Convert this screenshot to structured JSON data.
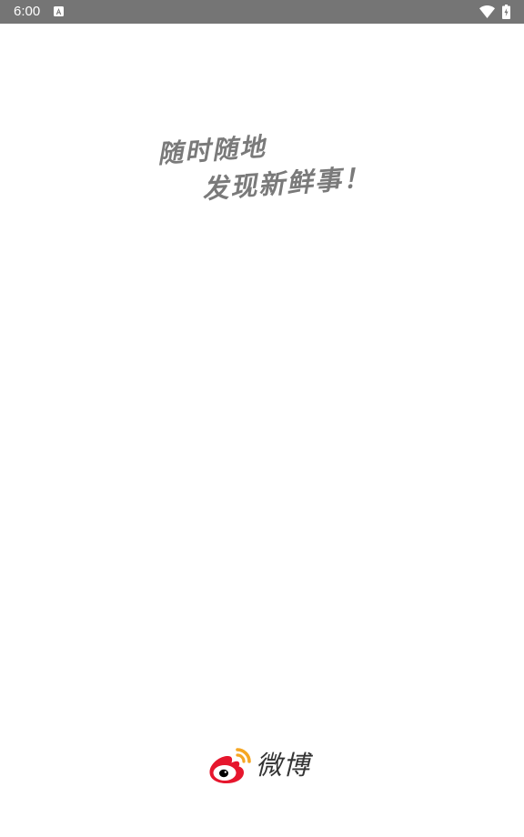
{
  "status_bar": {
    "time": "6:00",
    "background_color": "#757575",
    "icons": [
      "notification-a-icon",
      "wifi-icon",
      "battery-charging-icon"
    ]
  },
  "splash": {
    "slogan_line_1": "随时随地",
    "slogan_line_2": "发现新鲜事！",
    "slogan_color": "#7a7a7a"
  },
  "logo": {
    "text": "微博",
    "icon": "weibo-logo-icon",
    "brand_red": "#e6162d",
    "brand_orange": "#f5a623"
  }
}
